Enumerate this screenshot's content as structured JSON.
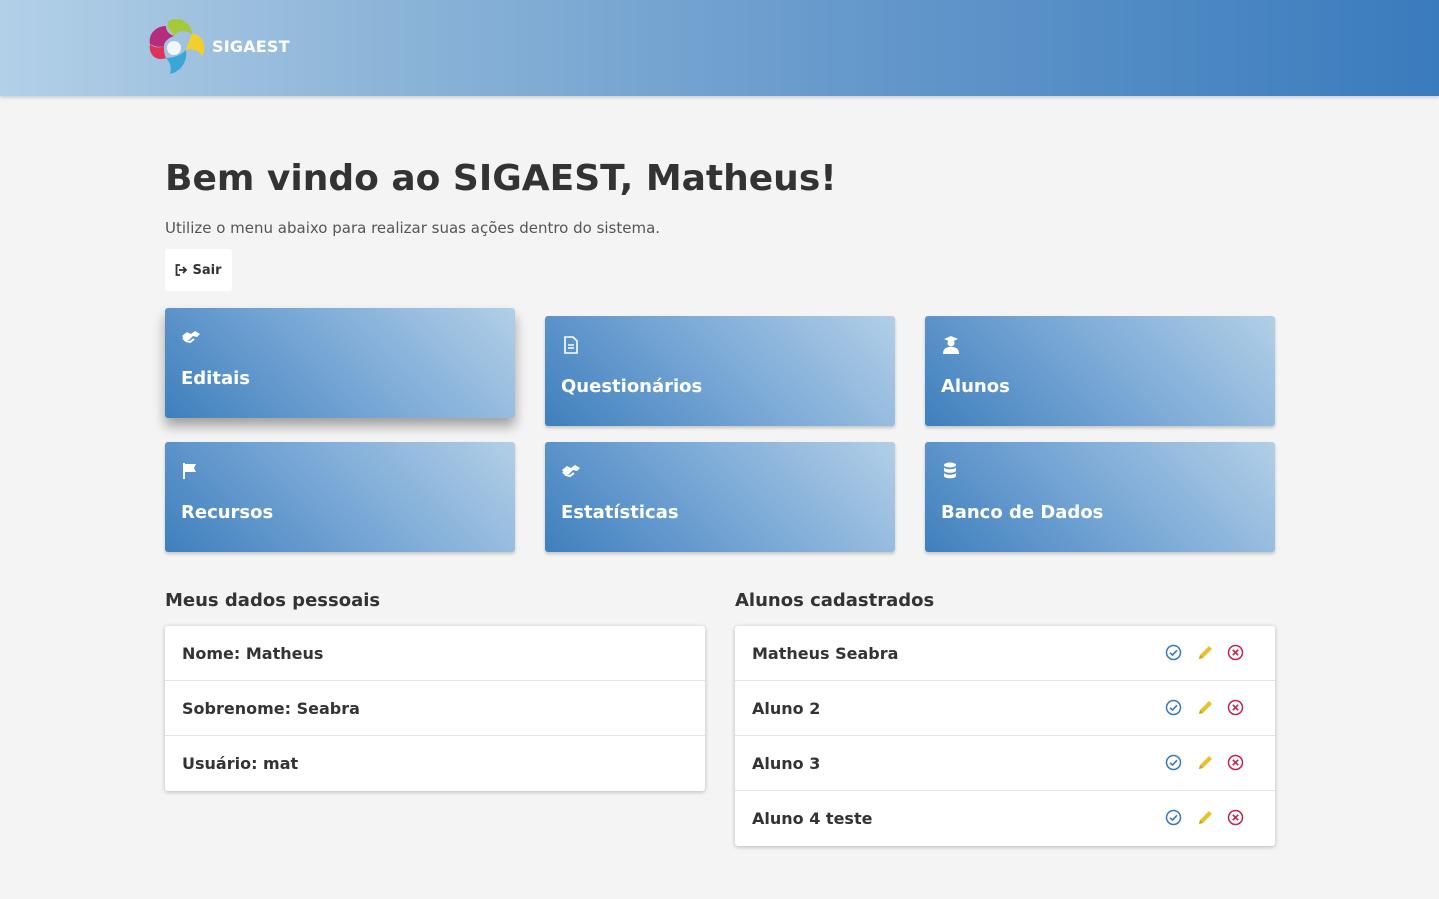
{
  "header": {
    "app_name": "SIGAEST",
    "colors": {
      "gradient_start": "#b3d0e8",
      "gradient_end": "#3a7bbd"
    }
  },
  "welcome": {
    "title": "Bem vindo ao SIGAEST, Matheus!",
    "subtitle": "Utilize o menu abaixo para realizar suas ações dentro do sistema.",
    "logout_label": "Sair",
    "logout_icon": "sign-out-icon"
  },
  "tiles": [
    {
      "label": "Editais",
      "icon": "handshake-icon"
    },
    {
      "label": "Questionários",
      "icon": "document-icon"
    },
    {
      "label": "Alunos",
      "icon": "graduate-icon"
    },
    {
      "label": "Recursos",
      "icon": "flag-icon"
    },
    {
      "label": "Estatísticas",
      "icon": "handshake-icon"
    },
    {
      "label": "Banco de Dados",
      "icon": "database-icon"
    }
  ],
  "personal": {
    "title": "Meus dados pessoais",
    "rows": [
      "Nome: Matheus",
      "Sobrenome: Seabra",
      "Usuário: mat"
    ]
  },
  "students": {
    "title": "Alunos cadastrados",
    "rows": [
      "Matheus Seabra",
      "Aluno 2",
      "Aluno 3",
      "Aluno 4 teste"
    ],
    "action_icons": [
      "check-circle-icon",
      "pencil-icon",
      "remove-circle-icon"
    ],
    "action_colors": {
      "check": "#3a78b5",
      "edit": "#e8c22e",
      "remove": "#c0254e"
    }
  }
}
